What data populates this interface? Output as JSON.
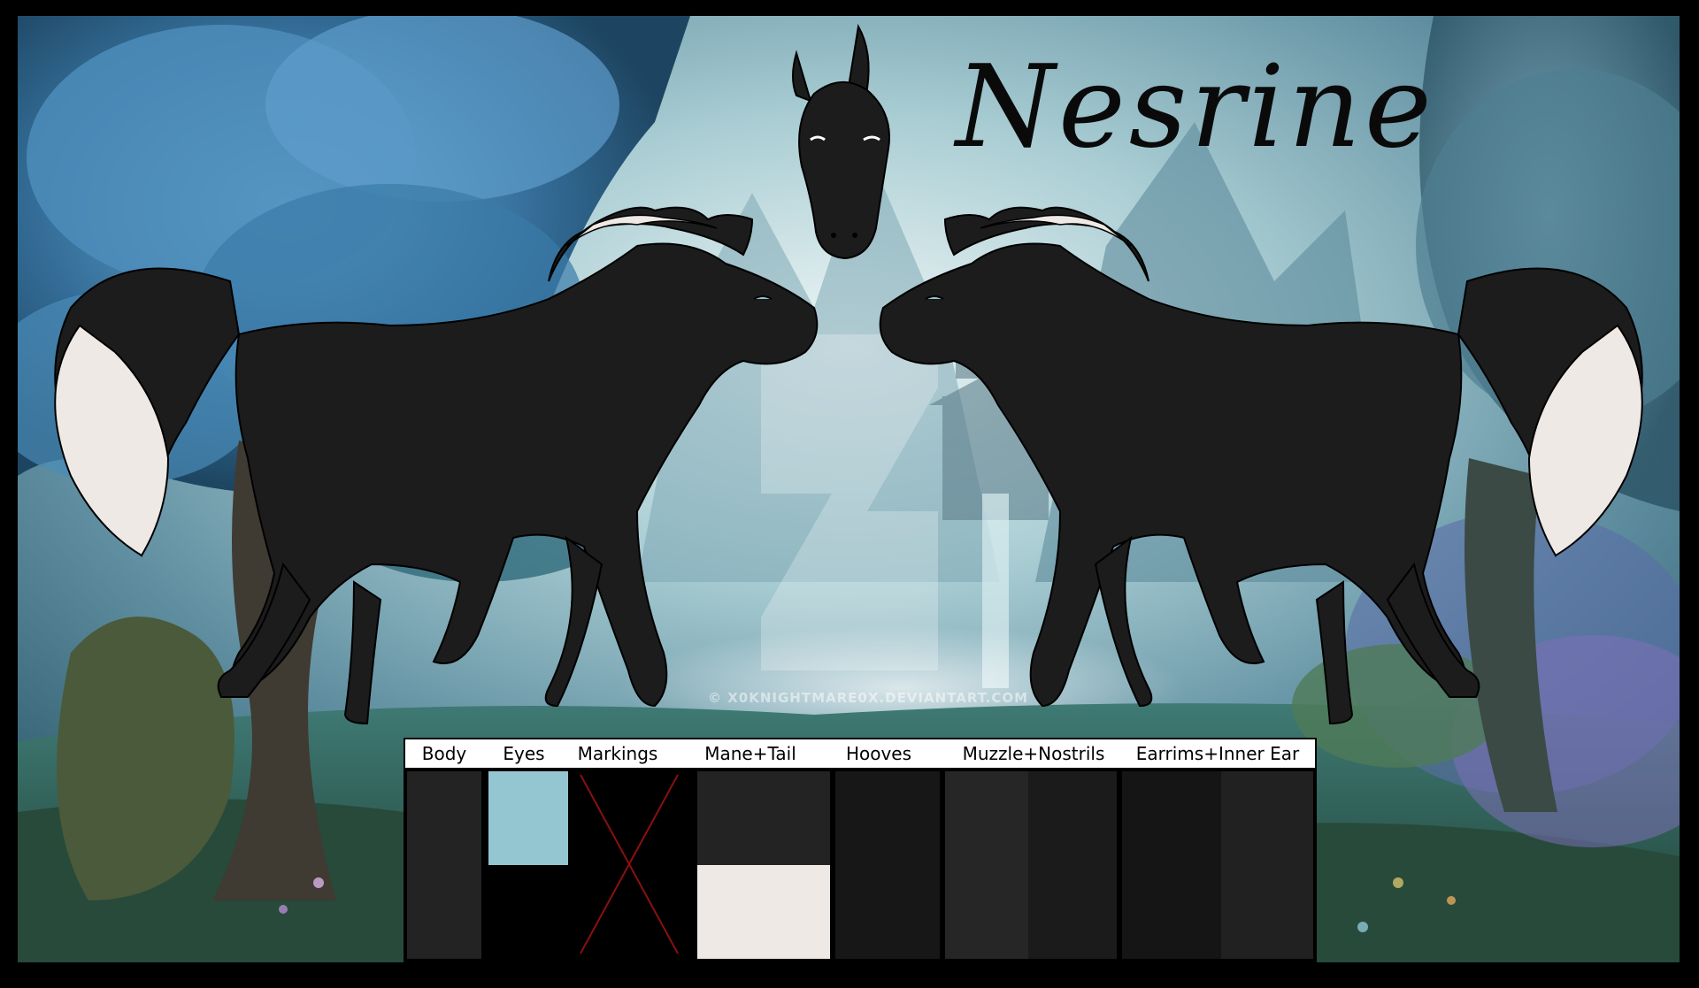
{
  "title": "Nesrine",
  "watermark": "© X0KNIGHTMARE0X.DEVIANTART.COM",
  "palette": {
    "headers": [
      "Body",
      "Eyes",
      "Markings",
      "Mane+Tail",
      "Hooves",
      "Muzzle+Nostrils",
      "Earrims+Inner Ear"
    ]
  },
  "colors": {
    "coat": "#1c1c1c",
    "mane": "#efe9e6",
    "eye": "#93c6d1",
    "muzzle": "#2a2a2a",
    "hoof": "#161616",
    "markings_cross": "#8b1010"
  }
}
